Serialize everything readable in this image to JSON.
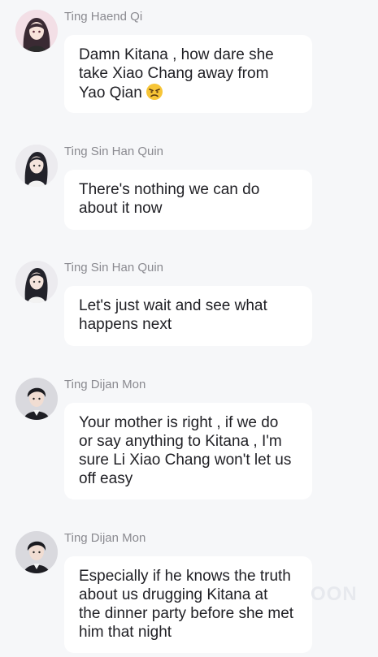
{
  "messages": [
    {
      "sender": "Ting Haend Qi",
      "avatar": "female-avatar-pink",
      "lines": [
        "Damn Kitana , how dare she",
        "take Xiao Chang away from",
        "Yao Qian"
      ],
      "emoji": "angry-face-icon"
    },
    {
      "sender": "Ting Sin Han Quin",
      "avatar": "female-avatar-dark-hair",
      "lines": [
        "There's nothing we can do",
        "about it now"
      ]
    },
    {
      "sender": "Ting Sin Han Quin",
      "avatar": "female-avatar-dark-hair",
      "lines": [
        "Let's just wait and see what",
        "happens next"
      ]
    },
    {
      "sender": "Ting Dijan Mon",
      "avatar": "male-avatar-suit",
      "lines": [
        "Your mother is right , if we do",
        "or say anything to Kitana , I'm",
        "sure Li Xiao Chang won't let us",
        "off easy"
      ]
    },
    {
      "sender": "Ting Dijan Mon",
      "avatar": "male-avatar-suit",
      "lines": [
        "Especially if he knows the truth",
        "about us drugging Kitana at",
        "the dinner party before she met",
        "him that night"
      ]
    }
  ],
  "watermark": "OON",
  "colors": {
    "background": "#f6f7f9",
    "bubble": "#ffffff",
    "sender_text": "#8a8a90",
    "message_text": "#1f1f24"
  }
}
